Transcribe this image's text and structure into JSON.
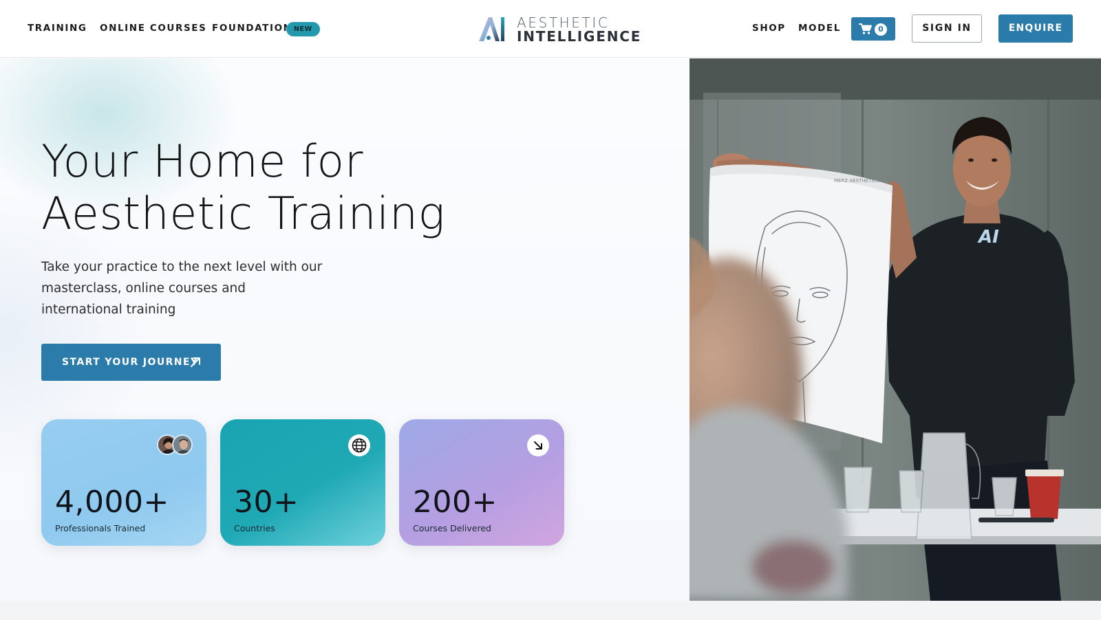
{
  "header": {
    "nav_left": [
      {
        "label": "TRAINING"
      },
      {
        "label": "ONLINE COURSES"
      },
      {
        "label": "FOUNDATION",
        "badge": "NEW"
      }
    ],
    "logo": {
      "line1": "AESTHETIC",
      "line2": "INTELLIGENCE",
      "mark_text": "AI"
    },
    "nav_right": [
      {
        "label": "SHOP"
      },
      {
        "label": "MODEL"
      }
    ],
    "cart": {
      "count": "0",
      "icon": "cart-icon"
    },
    "sign_in_label": "SIGN IN",
    "enquire_label": "ENQUIRE"
  },
  "hero": {
    "title_line1": "Your Home for",
    "title_line2": "Aesthetic Training",
    "subtitle": "Take your practice to the next level with our masterclass, online courses and international training",
    "cta_label": "START YOUR JOURNEY",
    "cta_icon": "arrow-up-right-icon",
    "stats": [
      {
        "value": "4,000+",
        "label": "Professionals Trained",
        "icon": "avatars"
      },
      {
        "value": "30+",
        "label": "Countries",
        "icon": "globe-icon"
      },
      {
        "value": "200+",
        "label": "Courses Delivered",
        "icon": "arrow-down-right-icon"
      }
    ],
    "photo": {
      "description": "trainer-holding-face-sketch",
      "shirt_logo": "AI",
      "paper_header": "MERZ AESTHETICS"
    }
  },
  "colors": {
    "brand_blue": "#2c7cab",
    "badge_teal": "#2499ad",
    "card_blue": "#97cdf0",
    "card_teal": "#1fa9b5",
    "card_purple": "#b49fe2"
  }
}
